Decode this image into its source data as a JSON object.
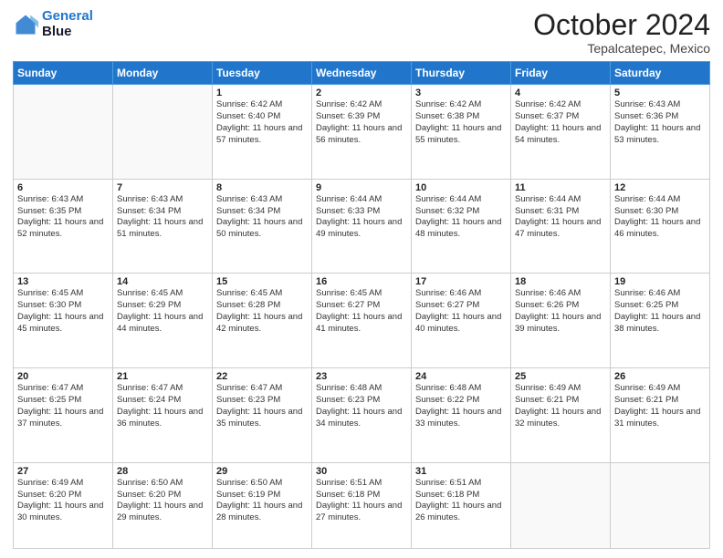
{
  "logo": {
    "line1": "General",
    "line2": "Blue"
  },
  "header": {
    "month": "October 2024",
    "location": "Tepalcatepec, Mexico"
  },
  "days_of_week": [
    "Sunday",
    "Monday",
    "Tuesday",
    "Wednesday",
    "Thursday",
    "Friday",
    "Saturday"
  ],
  "weeks": [
    [
      {
        "day": "",
        "info": ""
      },
      {
        "day": "",
        "info": ""
      },
      {
        "day": "1",
        "sunrise": "6:42 AM",
        "sunset": "6:40 PM",
        "daylight": "11 hours and 57 minutes."
      },
      {
        "day": "2",
        "sunrise": "6:42 AM",
        "sunset": "6:39 PM",
        "daylight": "11 hours and 56 minutes."
      },
      {
        "day": "3",
        "sunrise": "6:42 AM",
        "sunset": "6:38 PM",
        "daylight": "11 hours and 55 minutes."
      },
      {
        "day": "4",
        "sunrise": "6:42 AM",
        "sunset": "6:37 PM",
        "daylight": "11 hours and 54 minutes."
      },
      {
        "day": "5",
        "sunrise": "6:43 AM",
        "sunset": "6:36 PM",
        "daylight": "11 hours and 53 minutes."
      }
    ],
    [
      {
        "day": "6",
        "sunrise": "6:43 AM",
        "sunset": "6:35 PM",
        "daylight": "11 hours and 52 minutes."
      },
      {
        "day": "7",
        "sunrise": "6:43 AM",
        "sunset": "6:34 PM",
        "daylight": "11 hours and 51 minutes."
      },
      {
        "day": "8",
        "sunrise": "6:43 AM",
        "sunset": "6:34 PM",
        "daylight": "11 hours and 50 minutes."
      },
      {
        "day": "9",
        "sunrise": "6:44 AM",
        "sunset": "6:33 PM",
        "daylight": "11 hours and 49 minutes."
      },
      {
        "day": "10",
        "sunrise": "6:44 AM",
        "sunset": "6:32 PM",
        "daylight": "11 hours and 48 minutes."
      },
      {
        "day": "11",
        "sunrise": "6:44 AM",
        "sunset": "6:31 PM",
        "daylight": "11 hours and 47 minutes."
      },
      {
        "day": "12",
        "sunrise": "6:44 AM",
        "sunset": "6:30 PM",
        "daylight": "11 hours and 46 minutes."
      }
    ],
    [
      {
        "day": "13",
        "sunrise": "6:45 AM",
        "sunset": "6:30 PM",
        "daylight": "11 hours and 45 minutes."
      },
      {
        "day": "14",
        "sunrise": "6:45 AM",
        "sunset": "6:29 PM",
        "daylight": "11 hours and 44 minutes."
      },
      {
        "day": "15",
        "sunrise": "6:45 AM",
        "sunset": "6:28 PM",
        "daylight": "11 hours and 42 minutes."
      },
      {
        "day": "16",
        "sunrise": "6:45 AM",
        "sunset": "6:27 PM",
        "daylight": "11 hours and 41 minutes."
      },
      {
        "day": "17",
        "sunrise": "6:46 AM",
        "sunset": "6:27 PM",
        "daylight": "11 hours and 40 minutes."
      },
      {
        "day": "18",
        "sunrise": "6:46 AM",
        "sunset": "6:26 PM",
        "daylight": "11 hours and 39 minutes."
      },
      {
        "day": "19",
        "sunrise": "6:46 AM",
        "sunset": "6:25 PM",
        "daylight": "11 hours and 38 minutes."
      }
    ],
    [
      {
        "day": "20",
        "sunrise": "6:47 AM",
        "sunset": "6:25 PM",
        "daylight": "11 hours and 37 minutes."
      },
      {
        "day": "21",
        "sunrise": "6:47 AM",
        "sunset": "6:24 PM",
        "daylight": "11 hours and 36 minutes."
      },
      {
        "day": "22",
        "sunrise": "6:47 AM",
        "sunset": "6:23 PM",
        "daylight": "11 hours and 35 minutes."
      },
      {
        "day": "23",
        "sunrise": "6:48 AM",
        "sunset": "6:23 PM",
        "daylight": "11 hours and 34 minutes."
      },
      {
        "day": "24",
        "sunrise": "6:48 AM",
        "sunset": "6:22 PM",
        "daylight": "11 hours and 33 minutes."
      },
      {
        "day": "25",
        "sunrise": "6:49 AM",
        "sunset": "6:21 PM",
        "daylight": "11 hours and 32 minutes."
      },
      {
        "day": "26",
        "sunrise": "6:49 AM",
        "sunset": "6:21 PM",
        "daylight": "11 hours and 31 minutes."
      }
    ],
    [
      {
        "day": "27",
        "sunrise": "6:49 AM",
        "sunset": "6:20 PM",
        "daylight": "11 hours and 30 minutes."
      },
      {
        "day": "28",
        "sunrise": "6:50 AM",
        "sunset": "6:20 PM",
        "daylight": "11 hours and 29 minutes."
      },
      {
        "day": "29",
        "sunrise": "6:50 AM",
        "sunset": "6:19 PM",
        "daylight": "11 hours and 28 minutes."
      },
      {
        "day": "30",
        "sunrise": "6:51 AM",
        "sunset": "6:18 PM",
        "daylight": "11 hours and 27 minutes."
      },
      {
        "day": "31",
        "sunrise": "6:51 AM",
        "sunset": "6:18 PM",
        "daylight": "11 hours and 26 minutes."
      },
      {
        "day": "",
        "info": ""
      },
      {
        "day": "",
        "info": ""
      }
    ]
  ]
}
